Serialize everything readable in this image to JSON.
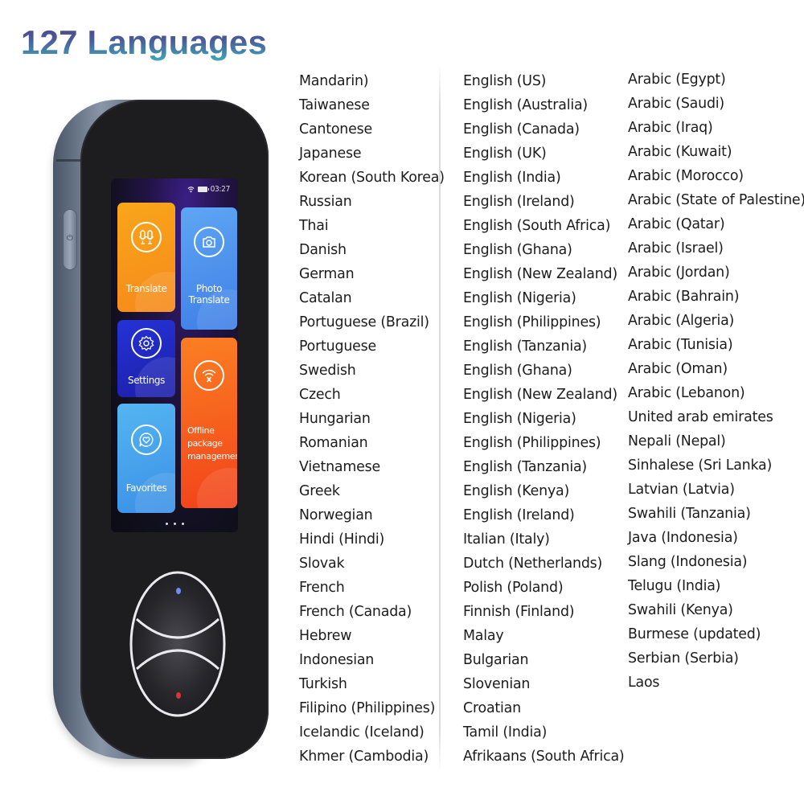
{
  "header": {
    "title": "127 Languages",
    "title_gradient": [
      "#4c3c86",
      "#3fb2bc"
    ]
  },
  "languages": {
    "column1": [
      "Mandarin)",
      "Taiwanese",
      "Cantonese",
      "Japanese",
      "Korean (South Korea)",
      "Russian",
      "Thai",
      "Danish",
      "German",
      "Catalan",
      "Portuguese (Brazil)",
      "Portuguese",
      "Swedish",
      "Czech",
      "Hungarian",
      "Romanian",
      "Vietnamese",
      "Greek",
      "Norwegian",
      "Hindi (Hindi)",
      "Slovak",
      "French",
      "French (Canada)",
      "Hebrew",
      "Indonesian",
      "Turkish",
      "Filipino (Philippines)",
      "Icelandic (Iceland)",
      "Khmer (Cambodia)"
    ],
    "column2": [
      "English (US)",
      "English (Australia)",
      "English (Canada)",
      "English (UK)",
      "English (India)",
      "English (Ireland)",
      "English (South Africa)",
      "English (Ghana)",
      "English (New Zealand)",
      "English (Nigeria)",
      "English (Philippines)",
      "English (Tanzania)",
      "English (Ghana)",
      "English (New Zealand)",
      "English (Nigeria)",
      "English (Philippines)",
      "English (Tanzania)",
      "English (Kenya)",
      "English (Ireland)",
      "Italian (Italy)",
      "Dutch (Netherlands)",
      "Polish (Poland)",
      "Finnish (Finland)",
      "Malay",
      "Bulgarian",
      "Slovenian",
      "Croatian",
      "Tamil (India)",
      "Afrikaans (South Africa)"
    ],
    "column3": [
      "Arabic (Egypt)",
      "Arabic (Saudi)",
      "Arabic (Iraq)",
      "Arabic (Kuwait)",
      "Arabic (Morocco)",
      "Arabic (State of Palestine)",
      "Arabic (Qatar)",
      "Arabic (Israel)",
      "Arabic (Jordan)",
      "Arabic (Bahrain)",
      "Arabic (Algeria)",
      "Arabic (Tunisia)",
      "Arabic (Oman)",
      "Arabic (Lebanon)",
      "United arab emirates",
      "Nepali (Nepal)",
      "Sinhalese (Sri Lanka)",
      "Latvian (Latvia)",
      "Swahili (Tanzania)",
      "Java (Indonesia)",
      "Slang (Indonesia)",
      "Telugu (India)",
      "Swahili (Kenya)",
      "Burmese (updated)",
      "Serbian (Serbia)",
      "Laos"
    ]
  },
  "device": {
    "status_bar": {
      "time": "03:27",
      "icons": [
        "wifi-icon",
        "battery-icon"
      ]
    },
    "tiles": [
      {
        "id": "translate",
        "label": "Translate",
        "icon": "microphone-icon"
      },
      {
        "id": "photo",
        "label": "Photo Translate",
        "icon": "camera-icon"
      },
      {
        "id": "settings",
        "label": "Settings",
        "icon": "gear-icon"
      },
      {
        "id": "offline",
        "label": "Offline package management",
        "icon": "wifi-off-icon"
      },
      {
        "id": "favorites",
        "label": "Favorites",
        "icon": "heart-bubble-icon"
      }
    ],
    "page_indicator": {
      "count": 3
    },
    "buttons": {
      "top_indicator_color": "#6f8cf2",
      "bottom_indicator_color": "#d9343d"
    },
    "power_icon": "power-icon"
  }
}
